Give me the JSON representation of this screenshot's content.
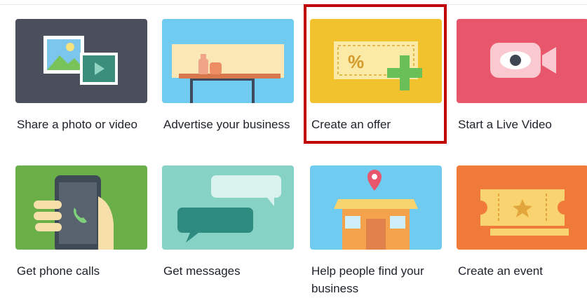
{
  "tiles": [
    {
      "label": "Share a photo or video",
      "icon": "photo-video-icon",
      "bg": "#4b4f5c"
    },
    {
      "label": "Advertise your business",
      "icon": "billboard-icon",
      "bg": "#6fcbef"
    },
    {
      "label": "Create an offer",
      "icon": "coupon-offer-icon",
      "bg": "#f2c12e",
      "highlighted": true
    },
    {
      "label": "Start a Live Video",
      "icon": "live-video-camera-icon",
      "bg": "#e8566c"
    },
    {
      "label": "Get phone calls",
      "icon": "phone-call-icon",
      "bg": "#6aaf48"
    },
    {
      "label": "Get messages",
      "icon": "messages-icon",
      "bg": "#86d3c6"
    },
    {
      "label": "Help people find your business",
      "icon": "storefront-location-icon",
      "bg": "#6fcbef"
    },
    {
      "label": "Create an event",
      "icon": "event-ticket-icon",
      "bg": "#ef7a3a"
    }
  ],
  "highlight_color": "#c00000"
}
